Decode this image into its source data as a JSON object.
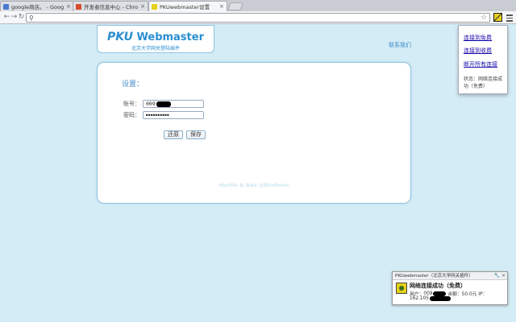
{
  "browser": {
    "tabs": [
      {
        "title": "google商店。 - Google",
        "favicon_color": "#4a7bd0",
        "active": false
      },
      {
        "title": "开发者信息中心 - Chrome",
        "favicon_color": "#d84a2a",
        "active": false
      },
      {
        "title": "PKUwebmaster设置",
        "favicon_color": "#e7d21a",
        "active": true
      }
    ],
    "close_glyph": "×"
  },
  "page": {
    "logo_title_pku": "PKU",
    "logo_title_rest": " Webmaster",
    "logo_subtitle": "北京大学网关登陆插件",
    "contact_link": "联系我们",
    "settings_title": "设置：",
    "account_label": "账号：",
    "account_value": "009",
    "password_label": "密码：",
    "password_value": "●●●●●●●●●●",
    "restore_button": "还原",
    "save_button": "保存",
    "credit": "Hurtle & Bee @Birdmen"
  },
  "popup": {
    "connect_free": "连接到免费",
    "connect_paid": "连接到收费",
    "disconnect_all": "断开所有连接",
    "status_label": "状态：",
    "status_text": "网络连接成功（免费）"
  },
  "notification": {
    "header": "PKUwebmaster（北京大学网关插件）",
    "title": "网络连接成功（免费）",
    "user_label": "用户：",
    "user_value": "009",
    "balance": "余额：50.0元",
    "ip_label": "IP：",
    "ip_value": "162.105"
  },
  "colors": {
    "accent": "#2a8fd0",
    "background": "#d4ecf6"
  }
}
